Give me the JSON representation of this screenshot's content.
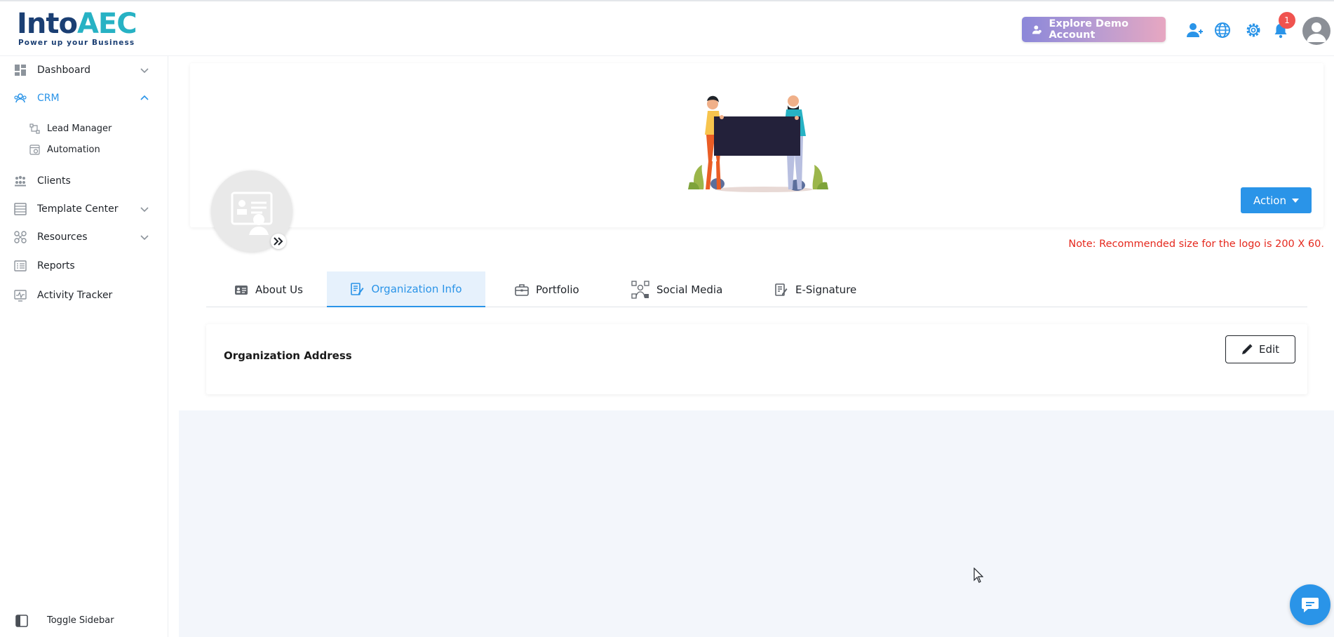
{
  "brand": {
    "logo_part1": "Into",
    "logo_part2": "AEC",
    "tagline": "Power up your Business"
  },
  "header": {
    "demo_button": "Explore Demo Account",
    "notification_count": "1"
  },
  "sidebar": {
    "items": [
      {
        "label": "Dashboard",
        "icon": "dashboard-icon",
        "expandable": true
      },
      {
        "label": "CRM",
        "icon": "crm-icon",
        "expanded": true
      },
      {
        "label": "Lead Manager",
        "icon": "lead-manager-icon"
      },
      {
        "label": "Automation",
        "icon": "automation-icon"
      },
      {
        "label": "Clients",
        "icon": "clients-icon"
      },
      {
        "label": "Template Center",
        "icon": "template-icon",
        "expandable": true
      },
      {
        "label": "Resources",
        "icon": "resources-icon",
        "expandable": true
      },
      {
        "label": "Reports",
        "icon": "reports-icon"
      },
      {
        "label": "Activity Tracker",
        "icon": "activity-icon"
      }
    ],
    "toggle_label": "Toggle Sidebar"
  },
  "banner": {
    "action_label": "Action",
    "note": "Note: Recommended size for the logo is 200 X 60."
  },
  "tabs": [
    {
      "label": "About Us",
      "icon": "about-icon"
    },
    {
      "label": "Organization Info",
      "icon": "org-info-icon",
      "active": true
    },
    {
      "label": "Portfolio",
      "icon": "portfolio-icon"
    },
    {
      "label": "Social Media",
      "icon": "social-media-icon"
    },
    {
      "label": "E-Signature",
      "icon": "signature-icon"
    }
  ],
  "card": {
    "title": "Organization Address",
    "edit_label": "Edit"
  },
  "colors": {
    "accent": "#2a94e8",
    "note_red": "#e5281d",
    "brand_navy": "#1b3f73",
    "brand_teal": "#27b2c4",
    "badge_red": "#f0534f"
  }
}
